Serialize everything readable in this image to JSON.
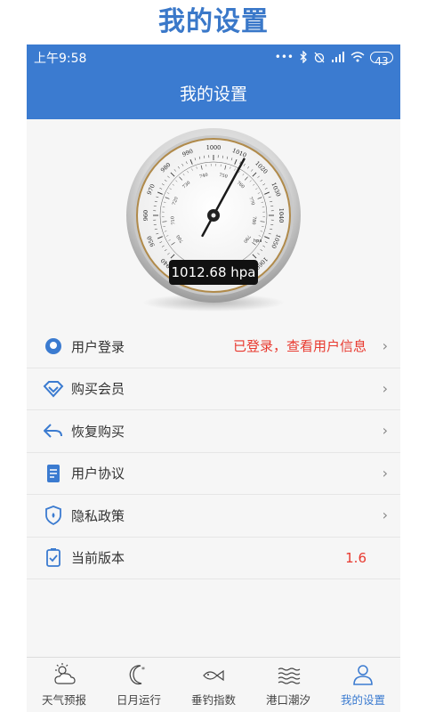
{
  "promo": {
    "title": "我的设置"
  },
  "status_bar": {
    "time": "上午9:58",
    "battery": "43"
  },
  "header": {
    "title": "我的设置"
  },
  "gauge": {
    "reading": "1012.68 hpa",
    "unit_label": "hpa",
    "outer_ticks": [
      "940",
      "950",
      "960",
      "970",
      "980",
      "990",
      "1000",
      "1010",
      "1020",
      "1030",
      "1040",
      "1050",
      "1060"
    ],
    "inner_ticks": [
      "700",
      "710",
      "720",
      "730",
      "740",
      "750",
      "760",
      "770",
      "780",
      "790"
    ],
    "needle_value": 1012.68
  },
  "menu": {
    "items": [
      {
        "label": "用户登录",
        "value": "已登录，查看用户信息",
        "icon": "user-icon"
      },
      {
        "label": "购买会员",
        "value": "",
        "icon": "diamond-icon"
      },
      {
        "label": "恢复购买",
        "value": "",
        "icon": "back-arrow-icon"
      },
      {
        "label": "用户协议",
        "value": "",
        "icon": "document-icon"
      },
      {
        "label": "隐私政策",
        "value": "",
        "icon": "shield-icon"
      },
      {
        "label": "当前版本",
        "value": "1.6",
        "icon": "version-icon"
      }
    ],
    "chevron": "›"
  },
  "tabs": [
    {
      "label": "天气预报",
      "icon": "weather-icon",
      "active": false
    },
    {
      "label": "日月运行",
      "icon": "moon-icon",
      "active": false
    },
    {
      "label": "垂钓指数",
      "icon": "fish-icon",
      "active": false
    },
    {
      "label": "港口潮汐",
      "icon": "waves-icon",
      "active": false
    },
    {
      "label": "我的设置",
      "icon": "person-icon",
      "active": true
    }
  ],
  "colors": {
    "brand": "#3b7bd0",
    "promo_title": "#3a78c9",
    "value_red": "#e8392f",
    "needle": "#1a1a1a"
  }
}
